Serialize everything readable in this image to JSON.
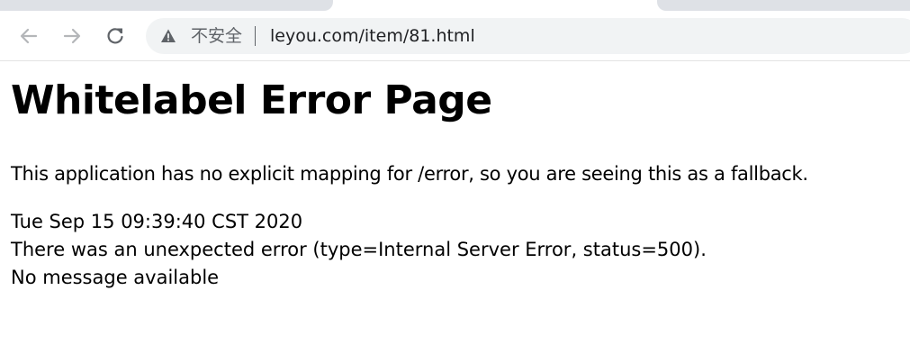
{
  "browser": {
    "security_label": "不安全",
    "url": "leyou.com/item/81.html",
    "icons": {
      "back": "arrow-back-icon",
      "forward": "arrow-forward-icon",
      "reload": "reload-icon",
      "warning": "warning-triangle-icon"
    }
  },
  "page": {
    "title": "Whitelabel Error Page",
    "description": "This application has no explicit mapping for /error, so you are seeing this as a fallback.",
    "timestamp": "Tue Sep 15 09:39:40 CST 2020",
    "error_line": "There was an unexpected error (type=Internal Server Error, status=500).",
    "message": "No message available"
  }
}
